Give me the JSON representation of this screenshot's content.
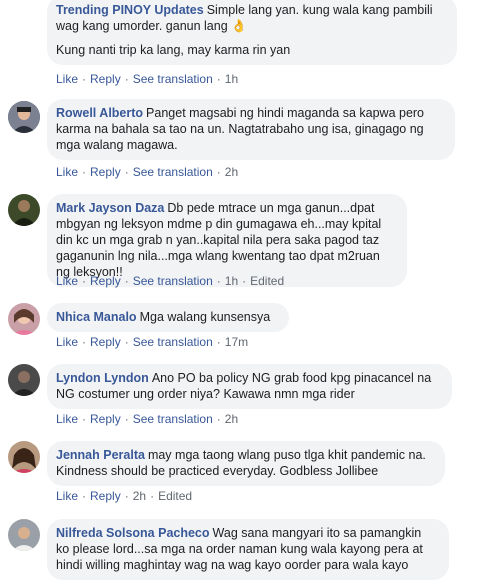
{
  "actions": {
    "like": "Like",
    "reply": "Reply",
    "see_translation": "See translation",
    "edited": "Edited",
    "dot": "·"
  },
  "comments": [
    {
      "author": "Trending PINOY Updates",
      "text": "Simple lang yan. kung wala kang pambili wag kang umorder. ganun lang 👌",
      "text2": "Kung nanti trip ka lang, may karma rin yan",
      "time": "1h",
      "avatar_icon": "page-avatar-icon"
    },
    {
      "author": "Rowell Alberto",
      "text": "Panget magsabi ng hindi maganda sa kapwa pero karma na bahala sa tao na un. Nagtatrabaho ung isa, ginagago ng mga walang magawa.",
      "time": "2h",
      "avatar_icon": "user-avatar-icon"
    },
    {
      "author": "Mark Jayson Daza",
      "text": "Db pede mtrace un mga ganun...dpat mbgyan ng leksyon mdme p din gumagawa eh...may kpital din kc un mga grab n yan..kapital nila pera saka pagod taz gaganunin lng nila...mga wlang kwentang tao dpat m2ruan ng leksyon!!",
      "time": "1h",
      "edited": true,
      "avatar_icon": "user-avatar-icon"
    },
    {
      "author": "Nhica Manalo",
      "text": "Mga walang kunsensya",
      "time": "17m",
      "avatar_icon": "user-avatar-icon"
    },
    {
      "author": "Lyndon Lyndon",
      "text": "Ano PO ba policy NG grab food kpg pinacancel na NG costumer ung order niya? Kawawa nmn mga rider",
      "time": "2h",
      "avatar_icon": "user-avatar-icon"
    },
    {
      "author": "Jennah Peralta",
      "text": "may mga taong wlang puso tlga khit pandemic na. Kindness should be practiced everyday. Godbless Jollibee",
      "time": "2h",
      "edited": true,
      "avatar_icon": "user-avatar-icon"
    },
    {
      "author": "Nilfreda Solsona Pacheco",
      "text": "Wag sana mangyari ito sa pamangkin ko please lord...sa mga na order naman kung wala kayong pera at hindi willing maghintay wag na wag kayo oorder para wala kayo",
      "avatar_icon": "user-avatar-icon"
    }
  ]
}
